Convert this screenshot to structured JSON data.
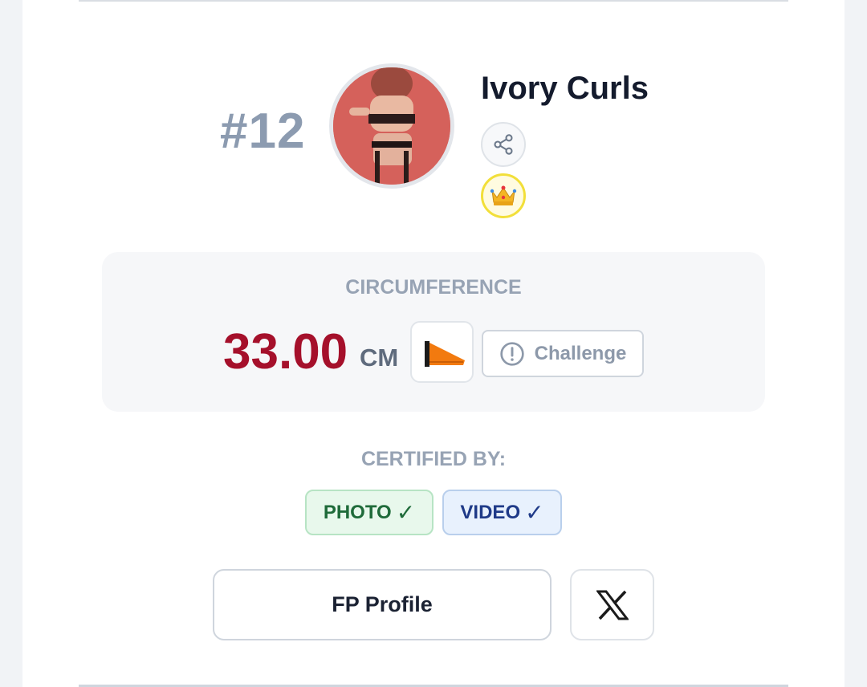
{
  "entry": {
    "rank": "#12",
    "name": "Ivory Curls"
  },
  "measurement": {
    "label": "CIRCUMFERENCE",
    "value": "33.00",
    "unit": "CM",
    "challenge_label": "Challenge"
  },
  "certification": {
    "label": "CERTIFIED BY:",
    "badges": [
      {
        "text": "PHOTO",
        "check": "✓"
      },
      {
        "text": "VIDEO",
        "check": "✓"
      }
    ]
  },
  "actions": {
    "profile_label": "FP Profile"
  },
  "icons": {
    "share": "share-icon",
    "crown": "crown-icon",
    "cone": "cone-icon",
    "alert": "alert-circle-icon",
    "x": "x-logo-icon"
  },
  "colors": {
    "value": "#a5102b",
    "rank": "#8c9bb0",
    "photo_badge": "#1f6b3a",
    "video_badge": "#1f3a88",
    "crown_ring": "#f2df3a"
  }
}
